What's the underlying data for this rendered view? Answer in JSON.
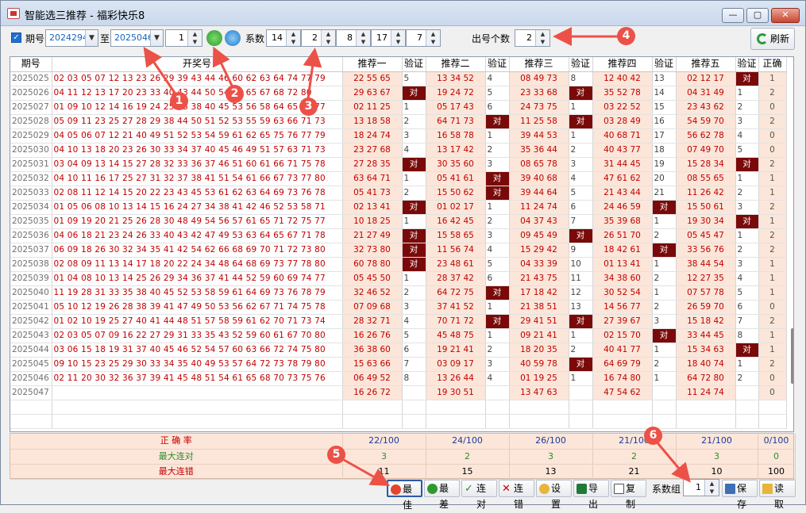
{
  "window": {
    "title": "智能选三推荐 - 福彩快乐8",
    "min": "—",
    "max": "▢",
    "close": "✕"
  },
  "toolbar": {
    "period_label": "期号",
    "period_from": "2024294",
    "to_label": "至",
    "period_to": "2025046",
    "step": "1",
    "coef_label": "系数",
    "coefs": [
      "14",
      "2",
      "8",
      "17",
      "7"
    ],
    "count_label": "出号个数",
    "count": "2",
    "refresh": "刷新"
  },
  "headers": [
    "期号",
    "开奖号",
    "推荐一",
    "验证",
    "推荐二",
    "验证",
    "推荐三",
    "验证",
    "推荐四",
    "验证",
    "推荐五",
    "验证",
    "正确"
  ],
  "rows": [
    [
      "2025025",
      "02 03 05 07 12 13 23 26 29 39 43 44 46 60 62 63 64 74 77 79",
      "22 55 65",
      "5",
      "13 34 52",
      "4",
      "08 49 73",
      "8",
      "12 40 42",
      "13",
      "02 12 17",
      "对",
      "1"
    ],
    [
      "2025026",
      "04 11 12 13 17 20 23 33 40 43 44 50 54 63 65 67 68 72 80",
      "29 63 67",
      "对",
      "19 24 72",
      "5",
      "23 33 68",
      "对",
      "35 52 78",
      "14",
      "04 31 49",
      "1",
      "2"
    ],
    [
      "2025027",
      "01 09 10 12 14 16 19 24 25 35 38 40 45 53 56 58 64 65 76 77",
      "02 11 25",
      "1",
      "05 17 43",
      "6",
      "24 73 75",
      "1",
      "03 22 52",
      "15",
      "23 43 62",
      "2",
      "0"
    ],
    [
      "2025028",
      "05 09 11 23 25 27 28 29 38 44 50 51 52 53 55 59 63 66 71 73",
      "13 18 58",
      "2",
      "64 71 73",
      "对",
      "11 25 58",
      "对",
      "03 28 49",
      "16",
      "54 59 70",
      "3",
      "2"
    ],
    [
      "2025029",
      "04 05 06 07 12 21 40 49 51 52 53 54 59 61 62 65 75 76 77 79",
      "18 24 74",
      "3",
      "16 58 78",
      "1",
      "39 44 53",
      "1",
      "40 68 71",
      "17",
      "56 62 78",
      "4",
      "0"
    ],
    [
      "2025030",
      "04 10 13 18 20 23 26 30 33 34 37 40 45 46 49 51 57 63 71 73",
      "23 27 68",
      "4",
      "13 17 42",
      "2",
      "35 36 44",
      "2",
      "40 43 77",
      "18",
      "07 49 70",
      "5",
      "0"
    ],
    [
      "2025031",
      "03 04 09 13 14 15 27 28 32 33 36 37 46 51 60 61 66 71 75 78",
      "27 28 35",
      "对",
      "30 35 60",
      "3",
      "08 65 78",
      "3",
      "31 44 45",
      "19",
      "15 28 34",
      "对",
      "2"
    ],
    [
      "2025032",
      "04 10 11 16 17 25 27 31 32 37 38 41 51 54 61 66 67 73 77 80",
      "63 64 71",
      "1",
      "05 41 61",
      "对",
      "39 40 68",
      "4",
      "47 61 62",
      "20",
      "08 55 65",
      "1",
      "1"
    ],
    [
      "2025033",
      "02 08 11 12 14 15 20 22 23 43 45 53 61 62 63 64 69 73 76 78",
      "05 41 73",
      "2",
      "15 50 62",
      "对",
      "39 44 64",
      "5",
      "21 43 44",
      "21",
      "11 26 42",
      "2",
      "1"
    ],
    [
      "2025034",
      "01 05 06 08 10 13 14 15 16 24 27 34 38 41 42 46 52 53 58 71",
      "02 13 41",
      "对",
      "01 02 17",
      "1",
      "11 24 74",
      "6",
      "24 46 59",
      "对",
      "15 50 61",
      "3",
      "2"
    ],
    [
      "2025035",
      "01 09 19 20 21 25 26 28 30 48 49 54 56 57 61 65 71 72 75 77",
      "10 18 25",
      "1",
      "16 42 45",
      "2",
      "04 37 43",
      "7",
      "35 39 68",
      "1",
      "19 30 34",
      "对",
      "1"
    ],
    [
      "2025036",
      "04 06 18 21 23 24 26 33 40 43 42 47 49 53 63 64 65 67 71 78",
      "21 27 49",
      "对",
      "15 58 65",
      "3",
      "09 45 49",
      "对",
      "26 51 70",
      "2",
      "05 45 47",
      "1",
      "2"
    ],
    [
      "2025037",
      "06 09 18 26 30 32 34 35 41 42 54 62 66 68 69 70 71 72 73 80",
      "32 73 80",
      "对",
      "11 56 74",
      "4",
      "15 29 42",
      "9",
      "18 42 61",
      "对",
      "33 56 76",
      "2",
      "2"
    ],
    [
      "2025038",
      "02 08 09 11 13 14 17 18 20 22 24 34 48 64 68 69 73 77 78 80",
      "60 78 80",
      "对",
      "23 48 61",
      "5",
      "04 33 39",
      "10",
      "01 13 41",
      "1",
      "38 44 54",
      "3",
      "1"
    ],
    [
      "2025039",
      "01 04 08 10 13 14 25 26 29 34 36 37 41 44 52 59 60 69 74 77",
      "05 45 50",
      "1",
      "28 37 42",
      "6",
      "21 43 75",
      "11",
      "34 38 60",
      "2",
      "12 27 35",
      "4",
      "1"
    ],
    [
      "2025040",
      "11 19 28 31 33 35 38 40 45 52 53 58 59 61 64 69 73 76 78 79",
      "32 46 52",
      "2",
      "64 72 75",
      "对",
      "17 18 42",
      "12",
      "30 52 54",
      "1",
      "07 57 78",
      "5",
      "1"
    ],
    [
      "2025041",
      "05 10 12 19 26 28 38 39 41 47 49 50 53 56 62 67 71 74 75 78",
      "07 09 68",
      "3",
      "37 41 52",
      "1",
      "21 38 51",
      "13",
      "14 56 77",
      "2",
      "26 59 70",
      "6",
      "0"
    ],
    [
      "2025042",
      "01 02 10 19 25 27 40 41 44 48 51 57 58 59 61 62 70 71 73 74",
      "28 32 71",
      "4",
      "70 71 72",
      "对",
      "29 41 51",
      "对",
      "27 39 67",
      "3",
      "15 18 42",
      "7",
      "2"
    ],
    [
      "2025043",
      "02 03 05 07 09 16 22 27 29 31 33 35 43 52 59 60 61 67 70 80",
      "16 26 76",
      "5",
      "45 48 75",
      "1",
      "09 21 41",
      "1",
      "02 15 70",
      "对",
      "33 44 45",
      "8",
      "1"
    ],
    [
      "2025044",
      "03 06 15 18 19 31 37 40 45 46 52 54 57 60 63 66 72 74 75 80",
      "36 38 60",
      "6",
      "19 21 41",
      "2",
      "18 20 35",
      "2",
      "40 41 77",
      "1",
      "15 34 63",
      "对",
      "1"
    ],
    [
      "2025045",
      "09 10 15 23 25 29 30 33 34 35 40 49 53 57 64 72 73 78 79 80",
      "15 63 66",
      "7",
      "03 09 17",
      "3",
      "40 59 78",
      "对",
      "64 69 79",
      "2",
      "18 40 74",
      "1",
      "2"
    ],
    [
      "2025046",
      "02 11 20 30 32 36 37 39 41 45 48 51 54 61 65 68 70 73 75 76",
      "06 49 52",
      "8",
      "13 26 44",
      "4",
      "01 19 25",
      "1",
      "16 74 80",
      "1",
      "64 72 80",
      "2",
      "0"
    ],
    [
      "2025047",
      "",
      "16 26 72",
      "",
      "19 30 51",
      "",
      "13 47 63",
      "",
      "47 54 62",
      "",
      "11 24 74",
      "",
      "0"
    ]
  ],
  "footer": [
    {
      "label": "正 确 率",
      "values": [
        "22/100",
        "24/100",
        "26/100",
        "21/100",
        "21/100",
        "0/100"
      ]
    },
    {
      "label": "最大连对",
      "values": [
        "3",
        "2",
        "3",
        "2",
        "3",
        "0"
      ]
    },
    {
      "label": "最大连错",
      "values": [
        "11",
        "15",
        "13",
        "21",
        "10",
        "100"
      ]
    }
  ],
  "bottom": {
    "best": "最佳",
    "worst": "最差",
    "lian_dui": "连对",
    "lian_cuo": "连错",
    "settings": "设置",
    "export": "导出",
    "copy": "复制",
    "coef_group_label": "系数组",
    "coef_group": "1",
    "save": "保存",
    "load": "读取"
  },
  "callouts": [
    "1",
    "2",
    "3",
    "4",
    "5",
    "6"
  ],
  "colors": {
    "hit": "#7a0a0a",
    "recommend_bg": "#fce6d9",
    "draw_text": "#c00000",
    "callout": "#ec5148"
  }
}
